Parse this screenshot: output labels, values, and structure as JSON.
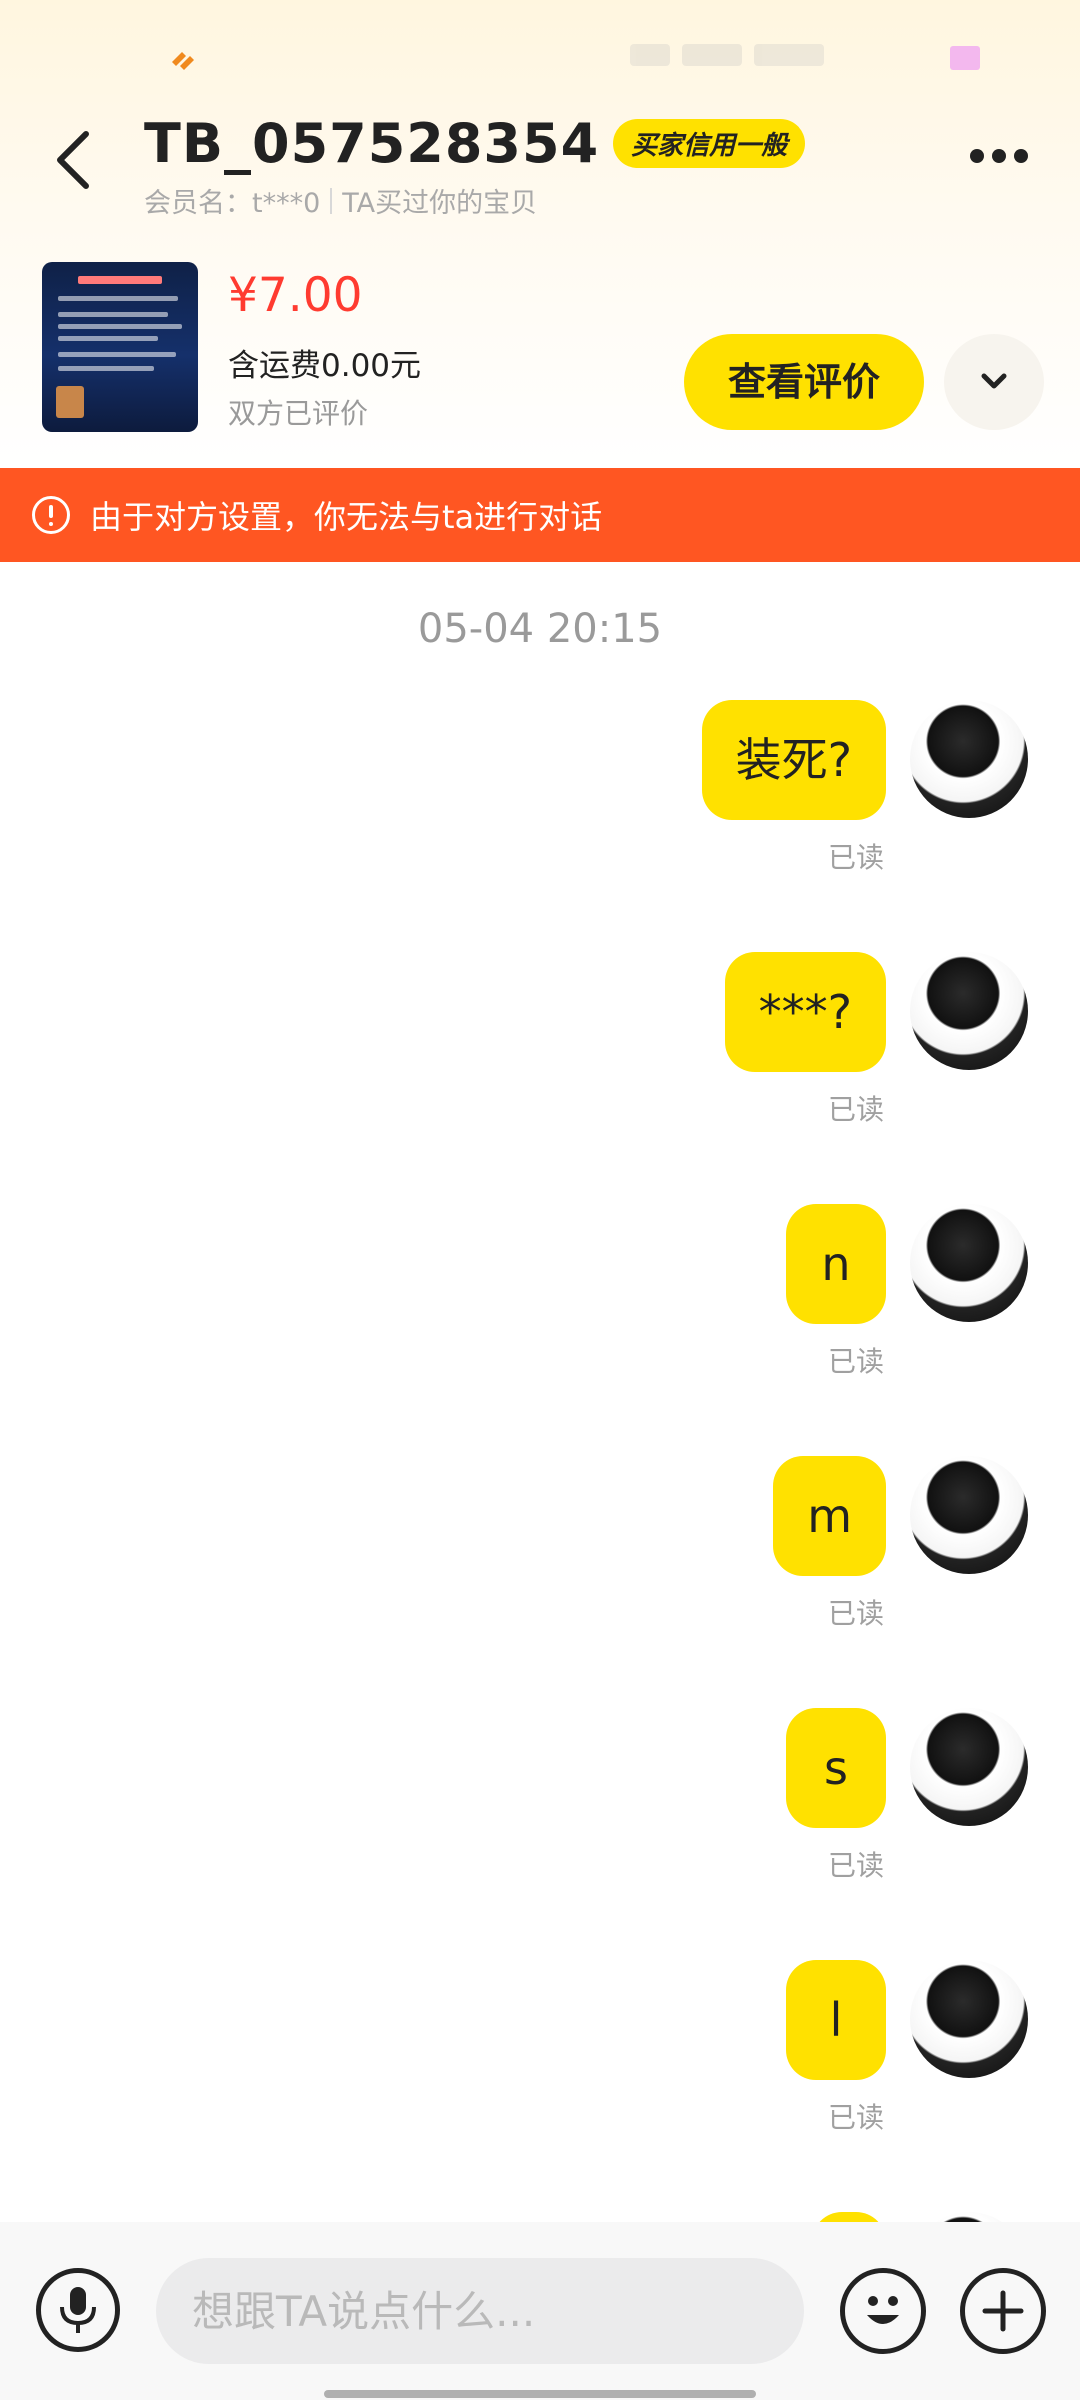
{
  "header": {
    "title": "TB_057528354",
    "credit_badge": "买家信用一般",
    "member_name": "会员名：t***0",
    "relation": "TA买过你的宝贝"
  },
  "product": {
    "price": "¥7.00",
    "shipping": "含运费0.00元",
    "evaluation_status": "双方已评价",
    "review_button": "查看评价"
  },
  "warning": {
    "text": "由于对方设置，你无法与ta进行对话"
  },
  "chat": {
    "timestamp": "05-04 20:15",
    "messages": [
      {
        "text": "装死?",
        "status": "已读"
      },
      {
        "text": "***?",
        "status": "已读"
      },
      {
        "text": "n",
        "status": "已读"
      },
      {
        "text": "m",
        "status": "已读"
      },
      {
        "text": "s",
        "status": "已读"
      },
      {
        "text": "l",
        "status": "已读"
      }
    ]
  },
  "input": {
    "placeholder": "想跟TA说点什么..."
  },
  "colors": {
    "accent_yellow": "#ffe100",
    "warning_red": "#ff5622",
    "price_red": "#ff3b30"
  }
}
